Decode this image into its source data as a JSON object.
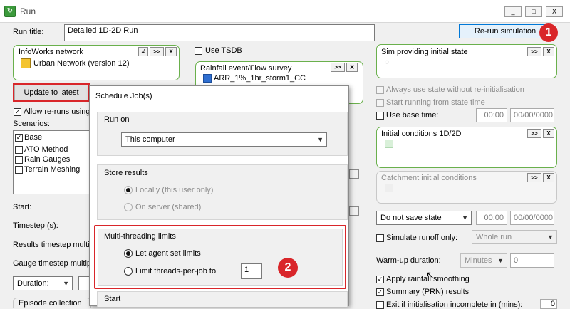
{
  "window": {
    "title": "Run",
    "app_icon": "run-app-icon",
    "controls": [
      "_",
      "□",
      "X"
    ]
  },
  "run_title": {
    "label": "Run title:",
    "value": "Detailed 1D-2D Run"
  },
  "rerun_button": {
    "label": "Re-run simulation"
  },
  "infoworks": {
    "label": "InfoWorks network",
    "item": "Urban Network (version 12)",
    "buttons": [
      "#",
      ">>",
      "X"
    ]
  },
  "use_tsdb": {
    "label": "Use TSDB"
  },
  "rainfall": {
    "label": "Rainfall event/Flow survey",
    "item": "ARR_1%_1hr_storm1_CC",
    "buttons": [
      ">>",
      "X"
    ]
  },
  "update_button": {
    "label": "Update to latest"
  },
  "allow_reruns": {
    "label": "Allow re-runs using"
  },
  "scenarios": {
    "label": "Scenarios:",
    "items": [
      {
        "name": "Base",
        "checked": true
      },
      {
        "name": "ATO Method",
        "checked": false
      },
      {
        "name": "Rain Gauges",
        "checked": false
      },
      {
        "name": "Terrain Meshing",
        "checked": false
      }
    ]
  },
  "left_labels": {
    "start": "Start:",
    "timestep": "Timestep (s):",
    "results_ts": "Results timestep multip",
    "gauge_ts": "Gauge timestep multip",
    "duration": "Duration:",
    "episode": "Episode collection"
  },
  "right": {
    "sim_state": {
      "label": "Sim providing initial state",
      "buttons": [
        ">>",
        "X"
      ]
    },
    "always_use": {
      "label": "Always use state without re-initialisation"
    },
    "start_running": {
      "label": "Start running from state time"
    },
    "use_base_time": {
      "label": "Use base time:",
      "time": "00:00",
      "date": "00/00/0000"
    },
    "initial_conditions": {
      "label": "Initial conditions 1D/2D",
      "buttons": [
        ">>",
        "X"
      ]
    },
    "catchment": {
      "label": "Catchment initial conditions",
      "buttons": [
        ">>",
        "X"
      ]
    },
    "save_state": {
      "value": "Do not save state",
      "time": "00:00",
      "date": "00/00/0000"
    },
    "simulate_runoff": {
      "label": "Simulate runoff only:",
      "value": "Whole run"
    },
    "warmup": {
      "label": "Warm-up duration:",
      "unit": "Minutes",
      "value": "0"
    },
    "apply_rainfall": {
      "label": "Apply rainfall smoothing"
    },
    "summary": {
      "label": "Summary (PRN) results"
    },
    "exit_init": {
      "label": "Exit if initialisation incomplete in (mins):",
      "value": "0"
    }
  },
  "dialog": {
    "title": "Schedule Job(s)",
    "run_on": {
      "label": "Run on",
      "value": "This computer"
    },
    "store": {
      "label": "Store results",
      "options": [
        "Locally (this user only)",
        "On server (shared)"
      ]
    },
    "threading": {
      "label": "Multi-threading limits",
      "options": [
        "Let agent set limits",
        "Limit threads-per-job to"
      ],
      "threads": "1"
    },
    "start_label": "Start"
  },
  "badges": [
    "1",
    "2"
  ],
  "colors": {
    "accent_red": "#d9262a",
    "group_green": "#6ab04c",
    "focus_blue": "#0078d7"
  }
}
